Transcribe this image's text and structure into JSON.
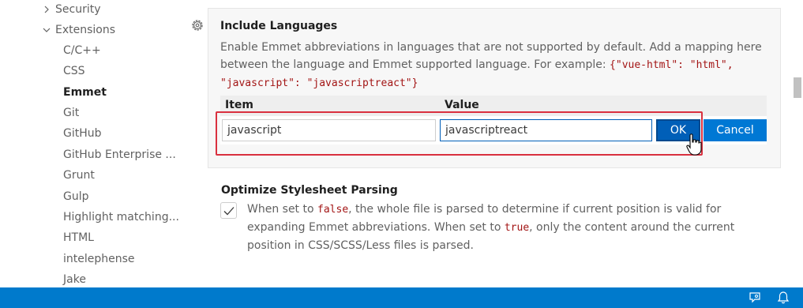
{
  "sidebar": {
    "groups": [
      {
        "label": "Security",
        "expanded": false
      },
      {
        "label": "Extensions",
        "expanded": true
      }
    ],
    "items": [
      {
        "label": "C/C++"
      },
      {
        "label": "CSS"
      },
      {
        "label": "Emmet",
        "active": true
      },
      {
        "label": "Git"
      },
      {
        "label": "GitHub"
      },
      {
        "label": "GitHub Enterprise ..."
      },
      {
        "label": "Grunt"
      },
      {
        "label": "Gulp"
      },
      {
        "label": "Highlight matching..."
      },
      {
        "label": "HTML"
      },
      {
        "label": "intelephense"
      },
      {
        "label": "Jake"
      }
    ]
  },
  "include_languages": {
    "title": "Include Languages",
    "desc_part1": "Enable Emmet abbreviations in languages that are not supported by default. Add a mapping here between the language and Emmet supported language. For example: ",
    "desc_code": "{\"vue-html\": \"html\", \"javascript\": \"javascriptreact\"}",
    "col_item": "Item",
    "col_value": "Value",
    "item_value": "javascript",
    "value_value": "javascriptreact",
    "ok_label": "OK",
    "cancel_label": "Cancel"
  },
  "optimize_stylesheet": {
    "title": "Optimize Stylesheet Parsing",
    "checked": true,
    "desc_a": "When set to ",
    "code_false": "false",
    "desc_b": ", the whole file is parsed to determine if current position is valid for expanding Emmet abbreviations. When set to ",
    "code_true": "true",
    "desc_c": ", only the content around the current position in CSS/SCSS/Less files is parsed."
  },
  "colors": {
    "statusbar": "#007acc",
    "accent": "#005fb8",
    "highlight": "#d9303f",
    "code": "#a31515"
  },
  "icons": [
    "gear-icon",
    "chevron-right-icon",
    "chevron-down-icon",
    "check-icon",
    "feedback-icon",
    "bell-icon",
    "mouse-pointer-icon"
  ]
}
